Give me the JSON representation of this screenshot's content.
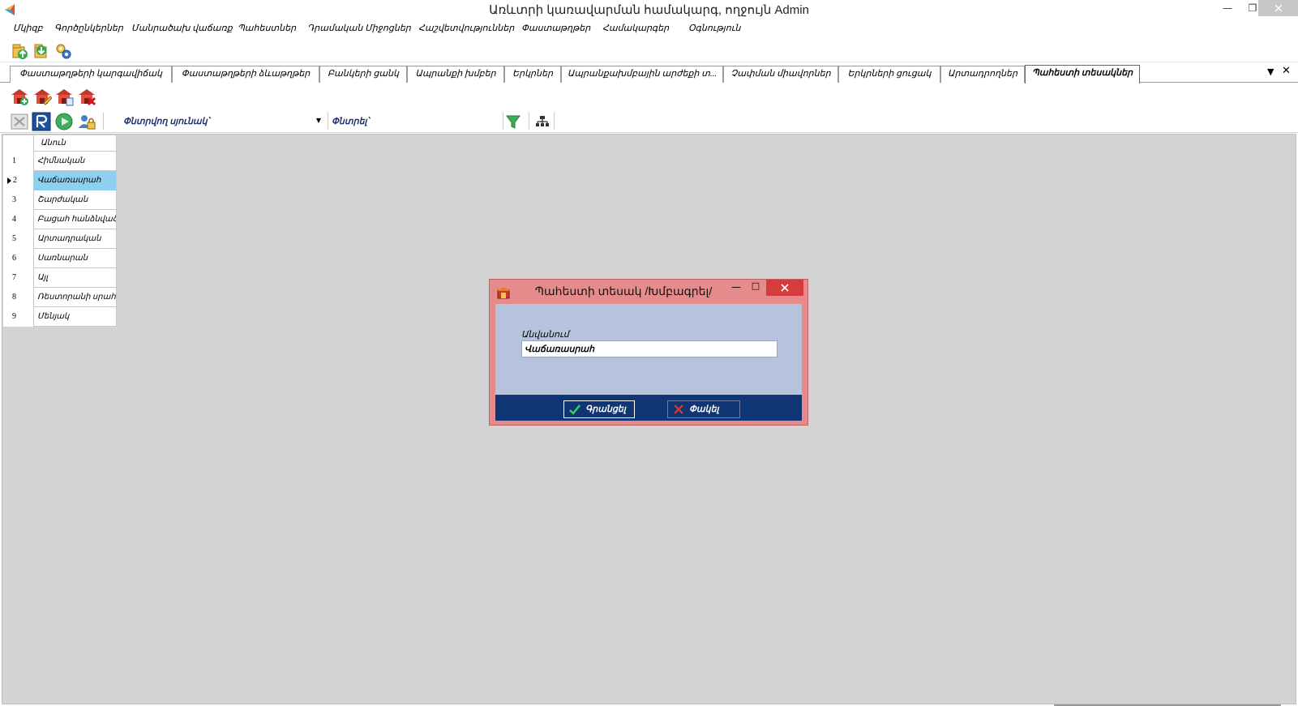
{
  "window": {
    "title": "Առևտրի կառավարման համակարգ, ողջույն Admin",
    "controls": [
      "minimize",
      "restore",
      "close"
    ]
  },
  "menu": [
    "Մկիզբ",
    "Գործընկերներ",
    "Մանրածախ վաճառք",
    "Պահեստներ",
    "Դրամական Միջոցներ",
    "Հաշվետվություններ",
    "Փաստաթղթեր",
    "Համակարգեր",
    "Օգնություն"
  ],
  "quick_toolbar": {
    "icons": [
      "upload-icon",
      "download-icon",
      "settings-gears-icon"
    ]
  },
  "tabs": [
    {
      "label": "Փաստաթղթերի կարգավիճակ",
      "active": false
    },
    {
      "label": "Փաստաթղթերի ձևաթղթեր",
      "active": false
    },
    {
      "label": "Բանկերի ցանկ",
      "active": false
    },
    {
      "label": "Ապրանքի խմբեր",
      "active": false
    },
    {
      "label": "Երկրներ",
      "active": false
    },
    {
      "label": "Ապրանքախմբային արժեքի տ...",
      "active": false
    },
    {
      "label": "Չափման միավորներ",
      "active": false
    },
    {
      "label": "Երկրների ցուցակ",
      "active": false
    },
    {
      "label": "Արտադրողներ",
      "active": false
    },
    {
      "label": "Պահեստի տեսակներ",
      "active": true
    }
  ],
  "action_toolbar": {
    "icons": [
      "add-warehouse-icon",
      "edit-warehouse-icon",
      "copy-warehouse-icon",
      "delete-warehouse-icon"
    ]
  },
  "filter_bar": {
    "search_column_label": "Փնտրվող սյունակ՝",
    "search_column_value": "",
    "search_label": "Փնտրել՝",
    "search_value": ""
  },
  "grid": {
    "column_header": "Անուն",
    "rows": [
      {
        "num": "1",
        "name": "Հիմնական",
        "selected": false
      },
      {
        "num": "2",
        "name": "Վաճառասրահ",
        "selected": true
      },
      {
        "num": "3",
        "name": "Շարժական",
        "selected": false
      },
      {
        "num": "4",
        "name": "Բացահ հանձնված",
        "selected": false
      },
      {
        "num": "5",
        "name": "Արտադրական",
        "selected": false
      },
      {
        "num": "6",
        "name": "Սառնարան",
        "selected": false
      },
      {
        "num": "7",
        "name": "Այլ",
        "selected": false
      },
      {
        "num": "8",
        "name": "Ռեստորանի սրահ",
        "selected": false
      },
      {
        "num": "9",
        "name": "Մենյակ",
        "selected": false
      }
    ]
  },
  "dialog": {
    "title": "Պահեստի տեսակ /Խմբագրել/",
    "field_label": "Անվանում",
    "field_value": "Վաճառասրահ",
    "ok_label": "Գրանցել",
    "cancel_label": "Փակել",
    "colors": {
      "frame": "#e58b8b",
      "body": "#b5c4dc",
      "footer": "#0f3574"
    }
  },
  "colors": {
    "selected_row": "#8ed0ef",
    "workspace": "#d4d4d4"
  }
}
